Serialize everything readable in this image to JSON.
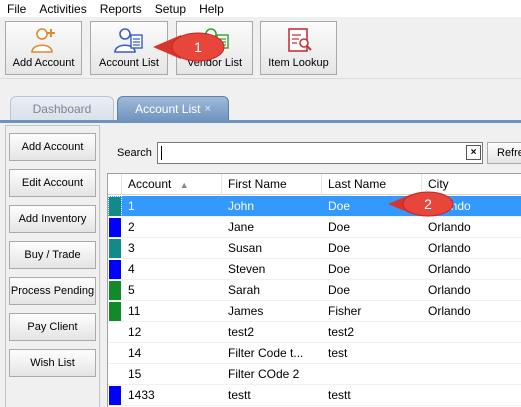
{
  "menu": [
    "File",
    "Activities",
    "Reports",
    "Setup",
    "Help"
  ],
  "toolbar": {
    "buttons": [
      {
        "label": "Add Account",
        "icon": "add-account-icon"
      },
      {
        "label": "Account List",
        "icon": "account-list-icon"
      },
      {
        "label": "Vendor List",
        "icon": "vendor-list-icon"
      },
      {
        "label": "Item Lookup",
        "icon": "item-lookup-icon"
      }
    ]
  },
  "callouts": {
    "one": "1",
    "two": "2"
  },
  "tabs": [
    {
      "label": "Dashboard",
      "active": false
    },
    {
      "label": "Account List",
      "active": true,
      "close": "×"
    }
  ],
  "sidebar": {
    "buttons": [
      "Add Account",
      "Edit Account",
      "Add Inventory",
      "Buy / Trade",
      "Process Pending",
      "Pay Client",
      "Wish List"
    ]
  },
  "search": {
    "label": "Search",
    "value": "",
    "clear": "×",
    "refresh_label": "Refresh"
  },
  "grid": {
    "columns": [
      "Account",
      "First Name",
      "Last Name",
      "City"
    ],
    "sort_indicator": "▲",
    "rows": [
      {
        "swatch": "#138a8a",
        "account": "1",
        "first": "John",
        "last": "Doe",
        "city": "Orlando",
        "selected": true
      },
      {
        "swatch": "#0000ff",
        "account": "2",
        "first": "Jane",
        "last": "Doe",
        "city": "Orlando"
      },
      {
        "swatch": "#138a8a",
        "account": "3",
        "first": "Susan",
        "last": "Doe",
        "city": "Orlando"
      },
      {
        "swatch": "#0000ff",
        "account": "4",
        "first": "Steven",
        "last": "Doe",
        "city": "Orlando"
      },
      {
        "swatch": "#138a2a",
        "account": "5",
        "first": "Sarah",
        "last": "Doe",
        "city": "Orlando"
      },
      {
        "swatch": "#138a2a",
        "account": "11",
        "first": "James",
        "last": "Fisher",
        "city": "Orlando"
      },
      {
        "swatch": "",
        "account": "12",
        "first": "test2",
        "last": "test2",
        "city": ""
      },
      {
        "swatch": "",
        "account": "14",
        "first": "Filter Code t...",
        "last": "test",
        "city": ""
      },
      {
        "swatch": "",
        "account": "15",
        "first": "Filter COde 2",
        "last": "",
        "city": ""
      },
      {
        "swatch": "#0000ff",
        "account": "1433",
        "first": "testt",
        "last": "testt",
        "city": ""
      }
    ]
  }
}
